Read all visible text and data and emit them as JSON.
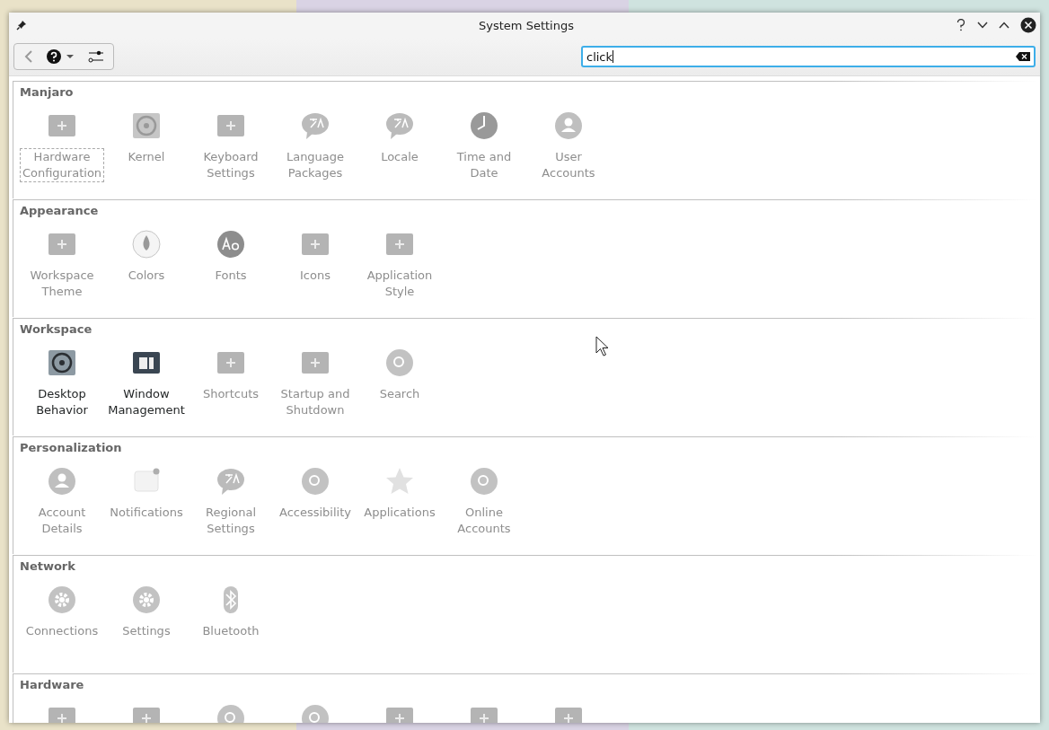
{
  "window": {
    "title": "System Settings"
  },
  "search": {
    "value": "click"
  },
  "sections": [
    {
      "title": "Manjaro",
      "kind": "full",
      "items": [
        {
          "label": "Hardware Configuration",
          "matched": false,
          "focused": true
        },
        {
          "label": "Kernel",
          "matched": false,
          "focused": false
        },
        {
          "label": "Keyboard Settings",
          "matched": false,
          "focused": false
        },
        {
          "label": "Language Packages",
          "matched": false,
          "focused": false
        },
        {
          "label": "Locale",
          "matched": false,
          "focused": false
        },
        {
          "label": "Time and Date",
          "matched": false,
          "focused": false
        },
        {
          "label": "User Accounts",
          "matched": false,
          "focused": false
        }
      ]
    },
    {
      "title": "Appearance",
      "kind": "full",
      "items": [
        {
          "label": "Workspace Theme",
          "matched": false,
          "focused": false
        },
        {
          "label": "Colors",
          "matched": false,
          "focused": false
        },
        {
          "label": "Fonts",
          "matched": false,
          "focused": false
        },
        {
          "label": "Icons",
          "matched": false,
          "focused": false
        },
        {
          "label": "Application Style",
          "matched": false,
          "focused": false
        }
      ]
    },
    {
      "title": "Workspace",
      "kind": "full",
      "items": [
        {
          "label": "Desktop Behavior",
          "matched": true,
          "focused": false
        },
        {
          "label": "Window Management",
          "matched": true,
          "focused": false
        },
        {
          "label": "Shortcuts",
          "matched": false,
          "focused": false
        },
        {
          "label": "Startup and Shutdown",
          "matched": false,
          "focused": false
        },
        {
          "label": "Search",
          "matched": false,
          "focused": false
        }
      ]
    },
    {
      "title": "Personalization",
      "kind": "full",
      "items": [
        {
          "label": "Account Details",
          "matched": false,
          "focused": false
        },
        {
          "label": "Notifications",
          "matched": false,
          "focused": false
        },
        {
          "label": "Regional Settings",
          "matched": false,
          "focused": false
        },
        {
          "label": "Accessibility",
          "matched": false,
          "focused": false
        },
        {
          "label": "Applications",
          "matched": false,
          "focused": false
        },
        {
          "label": "Online Accounts",
          "matched": false,
          "focused": false
        }
      ]
    },
    {
      "title": "Network",
      "kind": "full",
      "items": [
        {
          "label": "Connections",
          "matched": false,
          "focused": false
        },
        {
          "label": "Settings",
          "matched": false,
          "focused": false
        },
        {
          "label": "Bluetooth",
          "matched": false,
          "focused": false
        }
      ]
    },
    {
      "title": "Hardware",
      "kind": "cut_off"
    }
  ]
}
